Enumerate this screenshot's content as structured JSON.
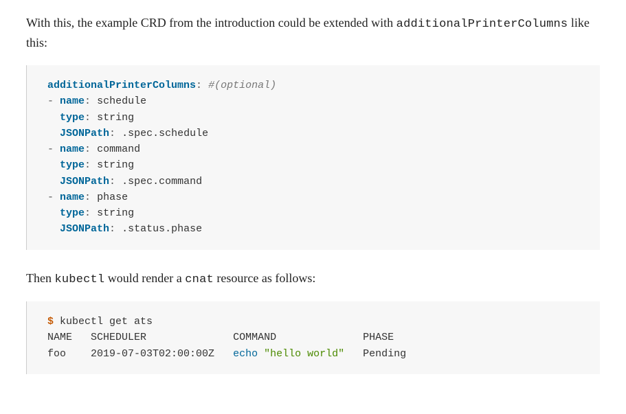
{
  "intro": {
    "part1": "With this, the example CRD from the introduction could be extended with ",
    "code1": "additionalPrinterColumns",
    "part2": " like this:"
  },
  "yaml": {
    "rootKey": "additionalPrinterColumns",
    "comment": "#(optional)",
    "items": [
      {
        "name": "schedule",
        "type": "string",
        "jsonPath": ".spec.schedule"
      },
      {
        "name": "command",
        "type": "string",
        "jsonPath": ".spec.command"
      },
      {
        "name": "phase",
        "type": "string",
        "jsonPath": ".status.phase"
      }
    ],
    "keys": {
      "name": "name",
      "type": "type",
      "jsonPath": "JSONPath"
    },
    "colon": ":",
    "dash": "-"
  },
  "mid": {
    "part1": "Then ",
    "kubectl": "kubectl",
    "part2": " would render a ",
    "cnat": "cnat",
    "part3": " resource as follows:"
  },
  "shell": {
    "prompt": "$",
    "command": "kubectl get ats",
    "header": {
      "name": "NAME",
      "scheduler": "SCHEDULER",
      "command": "COMMAND",
      "phase": "PHASE"
    },
    "row": {
      "name": "foo",
      "scheduler": "2019-07-03T02:00:00Z",
      "cmdPart": "echo",
      "strPart": "\"hello world\"",
      "phase": "Pending"
    }
  }
}
